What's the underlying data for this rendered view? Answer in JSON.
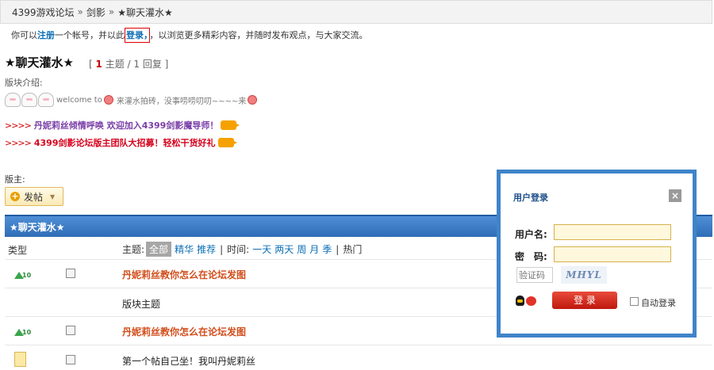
{
  "breadcrumb": {
    "home": "4399游戏论坛",
    "section": "剑影",
    "forum": "★聊天灌水★",
    "separator": "»"
  },
  "notice": {
    "prefix": "你可以",
    "register": "注册",
    "middle": "一个帐号，并以此",
    "login": "登录",
    "suffix": "，以浏览更多精彩内容，并随时发布观点，与大家交流。"
  },
  "forum": {
    "title": "★聊天灌水★",
    "topics_label": "主题",
    "replies_label": "回复",
    "topics": "1",
    "replies": "1",
    "intro_label": "版块介绍:",
    "welcome_caption": "welcome to",
    "tagline": "来灌水拍砖，没事唠唠叨叨~~~~来",
    "promos": [
      {
        "arrows": ">>>>",
        "text": "丹妮莉丝倾情呼唤 欢迎加入4399剑影魔导师！"
      },
      {
        "arrows": ">>>>",
        "text": "4399剑影论坛版主团队大招募！轻松干货好礼"
      }
    ],
    "moderator_label": "版主:"
  },
  "post_button": {
    "label": "发帖"
  },
  "table": {
    "header_title": "★聊天灌水★",
    "col_type": "类型",
    "filter": {
      "subject_label": "主题:",
      "all": "全部",
      "digest": "精华",
      "recommend": "推荐",
      "time_label": "时间:",
      "one_day": "一天",
      "two_days": "两天",
      "week": "周",
      "month": "月",
      "season": "季",
      "hot": "热门"
    },
    "rows": [
      {
        "subject": "丹妮莉丝教你怎么在论坛发图",
        "style": "hot"
      },
      {
        "subject": "版块主题",
        "style": "plain"
      },
      {
        "subject": "丹妮莉丝教你怎么在论坛发图",
        "style": "hot"
      },
      {
        "subject": "第一个帖自己坐！我叫丹妮莉丝",
        "style": "plain"
      }
    ]
  },
  "login_popup": {
    "title": "用户登录",
    "close": "×",
    "username_label": "用户名:",
    "password_label": "密　码:",
    "captcha_placeholder": "验证码",
    "captcha_code": "MHYL",
    "login_button": "登 录",
    "auto_login": "自动登录"
  },
  "colors": {
    "header_blue": "#2f6db6",
    "link_blue": "#0c6eb6",
    "hot_orange": "#d24f1d",
    "promo_purple": "#7a3ea8",
    "promo_red": "#d6001c",
    "login_red": "#c0180e"
  },
  "icons": {
    "row_icons": [
      "up-arrow-icon",
      "none",
      "up-arrow-icon",
      "document-icon"
    ]
  }
}
